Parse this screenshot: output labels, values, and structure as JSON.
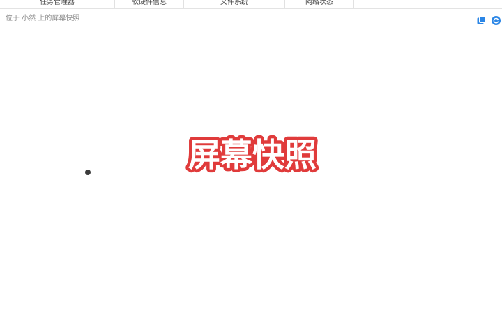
{
  "tabs": [
    {
      "label": "任务管理器"
    },
    {
      "label": "软硬件信息"
    },
    {
      "label": "文件系统"
    },
    {
      "label": "网络状态"
    }
  ],
  "header": {
    "title": "位于 小然 上的屏幕快照"
  },
  "main": {
    "heading": "屏幕快照"
  },
  "colors": {
    "heading_fill": "#ffffff",
    "heading_stroke": "#e03b3b",
    "icon_blue": "#2b86e6"
  },
  "icons": {
    "copy": "copy-window-icon",
    "refresh": "refresh-icon"
  }
}
